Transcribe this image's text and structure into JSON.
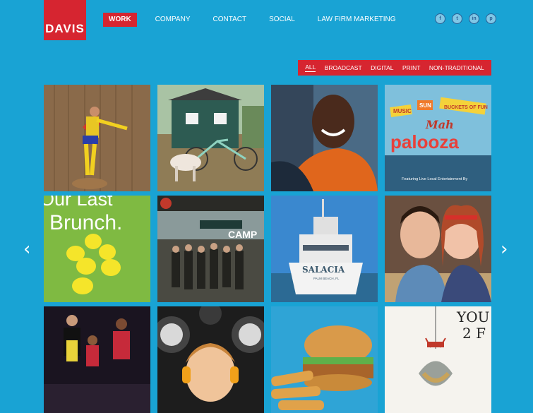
{
  "brand": {
    "logo_text": "DAVIS",
    "accent": "#d62530",
    "background": "#19a3d4"
  },
  "nav": {
    "items": [
      {
        "label": "WORK",
        "active": true
      },
      {
        "label": "COMPANY",
        "active": false
      },
      {
        "label": "CONTACT",
        "active": false
      },
      {
        "label": "SOCIAL",
        "active": false
      },
      {
        "label": "LAW FIRM MARKETING",
        "active": false
      }
    ]
  },
  "social": [
    {
      "name": "facebook-icon",
      "glyph": "f"
    },
    {
      "name": "twitter-icon",
      "glyph": "t"
    },
    {
      "name": "linkedin-icon",
      "glyph": "in"
    },
    {
      "name": "pinterest-icon",
      "glyph": "p"
    }
  ],
  "filters": [
    "ALL",
    "BROADCAST",
    "DIGITAL",
    "PRINT",
    "NON-TRADITIONAL"
  ],
  "carousel": {
    "prev_glyph": "‹",
    "next_glyph": "›"
  },
  "tiles": {
    "mahpalooza": {
      "line1": "MUSIC",
      "line2": "SUN",
      "line3": "BUCKETS OF FUN",
      "title1": "Mah",
      "title2": "palooza",
      "footer": "Featuring Live Local Entertainment By"
    },
    "brunch": {
      "line1": "Our Last",
      "line2": "Brunch."
    },
    "yacht": {
      "name": "SALACIA",
      "home": "PALM BEACH, FL"
    },
    "groomsmen": {
      "title": "CAMP"
    },
    "print": {
      "line1": "YOU",
      "line2": "2 F"
    }
  }
}
